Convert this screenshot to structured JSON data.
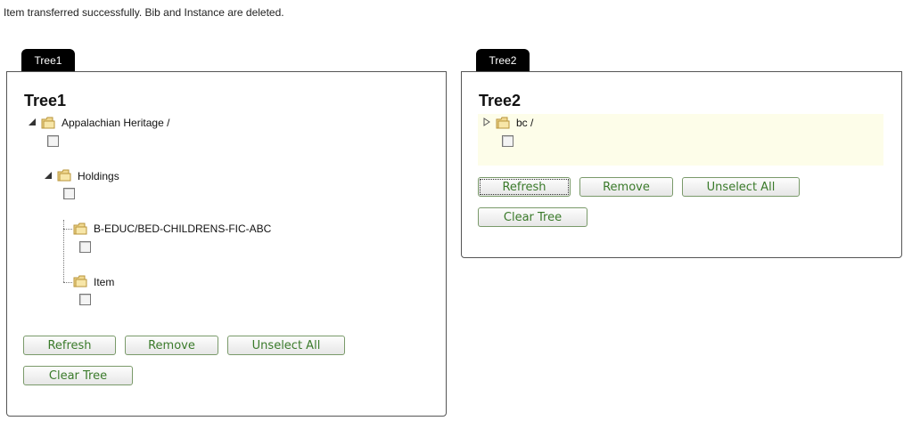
{
  "message": "Item transferred successfully. Bib and Instance are deleted.",
  "tree1": {
    "tab": "Tree1",
    "title": "Tree1",
    "nodes": {
      "root": "Appalachian Heritage /",
      "holdings": "Holdings",
      "location": "B-EDUC/BED-CHILDRENS-FIC-ABC",
      "item": "Item"
    },
    "buttons": {
      "refresh": "Refresh",
      "remove": "Remove",
      "unselect_all": "Unselect All",
      "clear_tree": "Clear Tree"
    }
  },
  "tree2": {
    "tab": "Tree2",
    "title": "Tree2",
    "nodes": {
      "root": "bc /"
    },
    "buttons": {
      "refresh": "Refresh",
      "remove": "Remove",
      "unselect_all": "Unselect All",
      "clear_tree": "Clear Tree"
    }
  },
  "colors": {
    "button_text": "#3a7a2a",
    "tab_bg": "#000000",
    "selected_row": "#fdfde9"
  },
  "icons": {
    "folder": "folder-icon",
    "expander": "expander-icon"
  }
}
